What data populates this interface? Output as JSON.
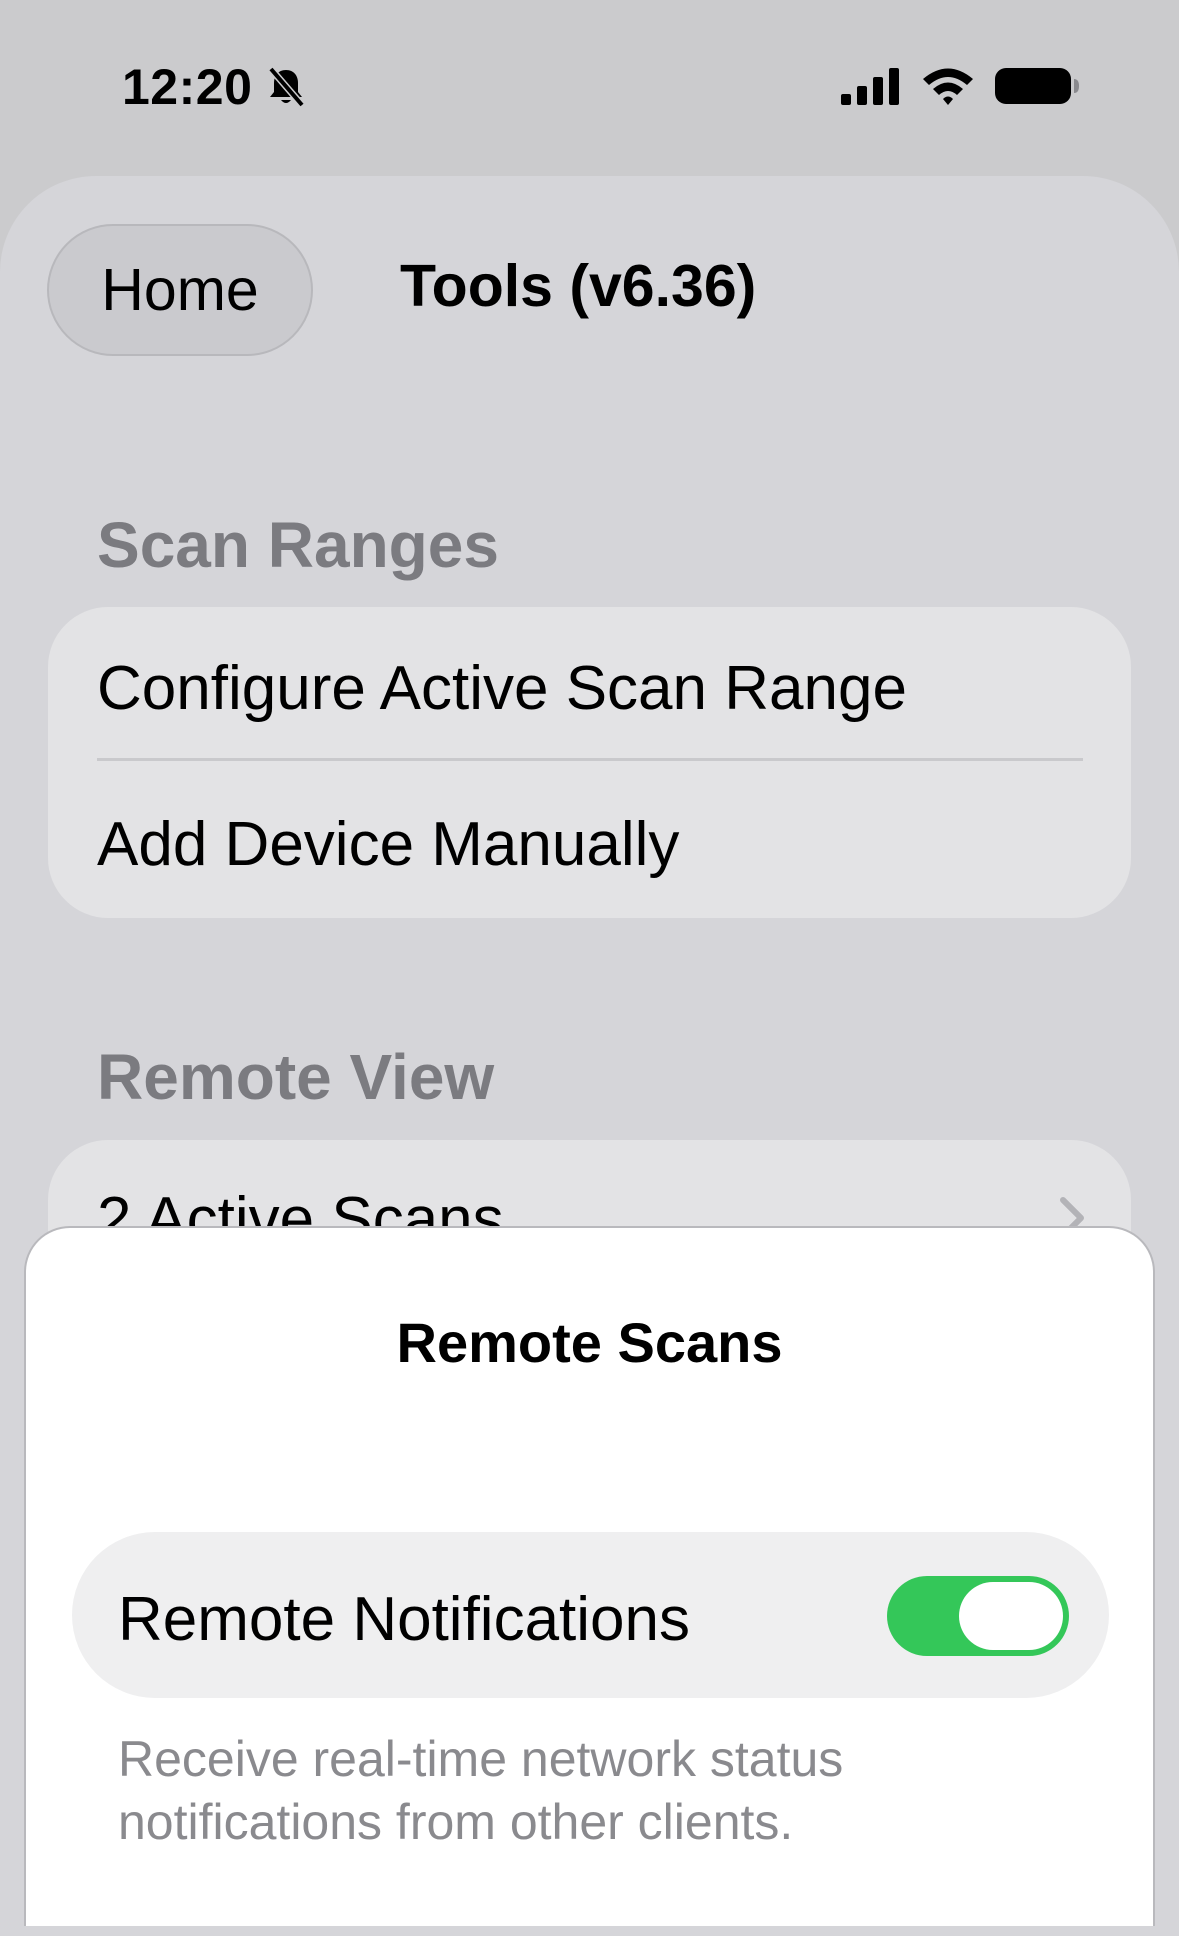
{
  "status_bar": {
    "time": "12:20",
    "icons": [
      "bell-slash-icon",
      "signal-icon",
      "wifi-icon",
      "battery-icon"
    ]
  },
  "nav": {
    "back_label": "Home",
    "title": "Tools (v6.36)"
  },
  "sections": {
    "scan_ranges": {
      "header": "Scan Ranges",
      "items": [
        "Configure Active Scan Range",
        "Add Device Manually"
      ]
    },
    "remote_view": {
      "header": "Remote View",
      "items": [
        "2 Active Scans"
      ]
    }
  },
  "modal": {
    "title": "Remote Scans",
    "toggle_label": "Remote Notifications",
    "toggle_on": true,
    "footer": "Receive real-time network status notifications from other clients."
  },
  "colors": {
    "toggle_on": "#34c759",
    "section_header": "#7b7b80"
  }
}
